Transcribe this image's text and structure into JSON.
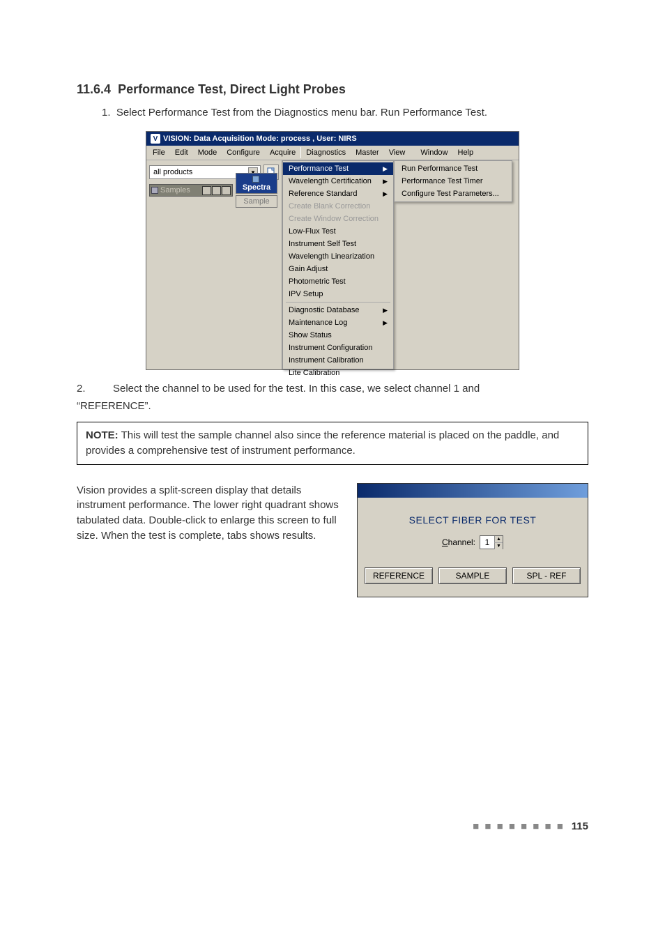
{
  "section": {
    "number": "11.6.4",
    "title": "Performance Test, Direct Light Probes"
  },
  "step1": {
    "prefix": "1.",
    "text": "Select Performance Test from the Diagnostics menu bar. Run Performance Test."
  },
  "app": {
    "titlebar": "VISION: Data Acquisition Mode: process , User: NIRS",
    "menubar_left": [
      "File",
      "Edit",
      "Mode",
      "Configure",
      "Acquire"
    ],
    "menubar_right": [
      "Diagnostics",
      "Master",
      "View",
      "Window",
      "Help"
    ],
    "product_dropdown": "all products",
    "samples_window_title": "Samples",
    "tabs": {
      "spectra": "Spectra",
      "sample": "Sample"
    },
    "diagnostics_menu": {
      "group1": [
        {
          "label": "Performance Test",
          "submenu": true,
          "highlight": true
        },
        {
          "label": "Wavelength Certification",
          "submenu": true
        },
        {
          "label": "Reference Standard",
          "submenu": true
        },
        {
          "label": "Create Blank Correction",
          "disabled": true
        },
        {
          "label": "Create Window Correction",
          "disabled": true
        },
        {
          "label": "Low-Flux Test"
        },
        {
          "label": "Instrument Self Test"
        },
        {
          "label": "Wavelength Linearization"
        },
        {
          "label": "Gain Adjust"
        },
        {
          "label": "Photometric Test"
        },
        {
          "label": "IPV Setup"
        }
      ],
      "group2": [
        {
          "label": "Diagnostic Database",
          "submenu": true
        },
        {
          "label": "Maintenance Log",
          "submenu": true
        },
        {
          "label": "Show Status"
        },
        {
          "label": "Instrument Configuration"
        },
        {
          "label": "Instrument Calibration"
        },
        {
          "label": "Lite Calibration"
        }
      ]
    },
    "perf_submenu": [
      "Run Performance Test",
      "Performance Test Timer",
      "Configure Test Parameters..."
    ]
  },
  "step2": {
    "prefix": "2.",
    "line1": "Select the channel to be used for the test. In this case, we select channel 1 and",
    "line2": "“REFERENCE”."
  },
  "note": {
    "label": "NOTE:",
    "text": " This will test the sample channel also since the reference material is placed on the paddle, and provides a comprehensive test of instrument performance."
  },
  "paragraph": "Vision provides a split-screen display that details instrument performance. The lower right quadrant shows tabulated data. Double-click to enlarge this screen to full size. When the test is complete, tabs shows results.",
  "dialog": {
    "heading": "SELECT FIBER FOR TEST",
    "channel_label_u": "C",
    "channel_label_rest": "hannel:",
    "channel_value": "1",
    "buttons": [
      "REFERENCE",
      "SAMPLE",
      "SPL - REF"
    ]
  },
  "page_number": "115"
}
